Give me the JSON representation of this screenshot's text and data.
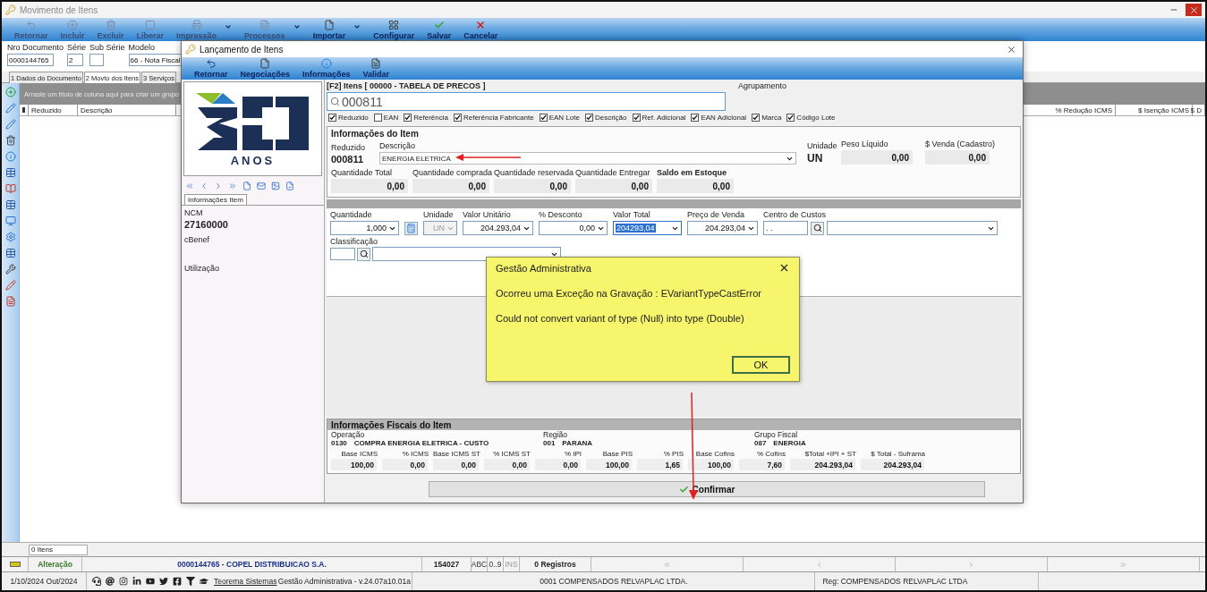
{
  "window": {
    "title": "Movimento de Itens"
  },
  "toolbar": [
    {
      "label": "Retornar",
      "disabled": true,
      "menu": false
    },
    {
      "label": "Incluir",
      "disabled": true,
      "menu": false
    },
    {
      "label": "Excluir",
      "disabled": true,
      "menu": false
    },
    {
      "label": "Liberar",
      "disabled": true,
      "menu": false
    },
    {
      "label": "Impressão",
      "disabled": true,
      "menu": true
    },
    {
      "label": "Processos",
      "disabled": true,
      "menu": true
    },
    {
      "label": "Importar",
      "disabled": false,
      "menu": true
    },
    {
      "label": "Configurar",
      "disabled": false,
      "menu": false
    },
    {
      "label": "Salvar",
      "disabled": false,
      "menu": false
    },
    {
      "label": "Cancelar",
      "disabled": false,
      "menu": false
    }
  ],
  "document_fields": [
    {
      "label": "Nro Documento",
      "value": "0000144765"
    },
    {
      "label": "Série",
      "value": "2"
    },
    {
      "label": "Sub Série"
    },
    {
      "label": "Modelo",
      "value": "66 - Nota Fiscal"
    }
  ],
  "tabs": [
    {
      "label": "1 Dados do Documento",
      "selected": false
    },
    {
      "label": "2 Movto dos Itens",
      "selected": true
    },
    {
      "label": "3 Serviços",
      "selected": false
    }
  ],
  "grid": {
    "group_hint": "Arraste um titulo de coluna aqui para criar um grupo",
    "columns": [
      "Reduzido",
      "Descrição"
    ],
    "right_columns": [
      "% Redução ICMS",
      "$ Isenção ICMS",
      "$ D"
    ]
  },
  "item_count": "0 Itens",
  "status_bar": {
    "mode": "Alteração",
    "document": "0000144765 - COPEL DISTRIBUICAO S.A.",
    "code": "154027",
    "indicators": [
      "ABC",
      "0..9",
      "INS"
    ],
    "records": "0 Registros"
  },
  "footer": {
    "date": "1/10/2024 Out/2024",
    "link": "Teorema Sistemas",
    "version": "Gestão Administrativa - v.24.07a10.01a",
    "company": "0001 COMPENSADOS RELVAPLAC LTDA.",
    "reg": "Reg: COMPENSADOS RELVAPLAC LTDA"
  },
  "dialog": {
    "title": "Lançamento de Itens",
    "toolbar": [
      "Retornar",
      "Negociações",
      "Informações",
      "Validar"
    ],
    "logo_text": "ANOS",
    "info_tab": "Informações Item",
    "info_fields": [
      {
        "label": "NCM",
        "value": "27160000"
      },
      {
        "label": "cBenef"
      },
      {
        "label": "Utilização"
      }
    ],
    "search_title": "[F2] Itens [ 00000 - TABELA DE PRECOS ]",
    "search_value": "000811",
    "grouping_label": "Agrupamento",
    "filters": [
      {
        "label": "Reduzido",
        "checked": true
      },
      {
        "label": "EAN",
        "checked": false
      },
      {
        "label": "Referência",
        "checked": true
      },
      {
        "label": "Referência Fabricante",
        "checked": true
      },
      {
        "label": "EAN Lote",
        "checked": true
      },
      {
        "label": "Descrição",
        "checked": true
      },
      {
        "label": "Ref. Adicional",
        "checked": true
      },
      {
        "label": "EAN Adicional",
        "checked": true
      },
      {
        "label": "Marca",
        "checked": true
      },
      {
        "label": "Código Lote",
        "checked": true
      }
    ],
    "item": {
      "title": "Informações do Item",
      "code_label": "Reduzido",
      "code": "000811",
      "description_label": "Descrição",
      "description": "ENERGIA ELETRICA",
      "unit_label": "Unidade",
      "unit": "UN",
      "weight_label": "Peso Líquido",
      "weight": "0,00",
      "price_label": "$ Venda (Cadastro)",
      "price": "0,00",
      "quantities": [
        {
          "label": "Quantidade Total",
          "value": "0,00"
        },
        {
          "label": "Quantidade comprada",
          "value": "0,00"
        },
        {
          "label": "Quantidade reservada",
          "value": "0,00"
        },
        {
          "label": "Quantidade Entregar",
          "value": "0,00"
        },
        {
          "label": "Saldo em Estoque",
          "value": "0,00"
        }
      ]
    },
    "entry": [
      {
        "label": "Quantidade",
        "value": "1,000",
        "kind": "dropdown"
      },
      {
        "label": "Unidade",
        "value": "UN",
        "kind": "unit"
      },
      {
        "label": "Valor Unitário",
        "value": "204.293,04",
        "kind": "dropdown"
      },
      {
        "label": "% Desconto",
        "value": "0,00",
        "kind": "dropdown"
      },
      {
        "label": "Valor Total",
        "value": "204293,04",
        "kind": "selected"
      },
      {
        "label": "Preço de Venda",
        "value": "204.293,04",
        "kind": "dropdown"
      },
      {
        "label": "Centro de Custos",
        "value": ". .",
        "kind": "lookup"
      }
    ],
    "classification_label": "Classificação",
    "fiscal": {
      "title": "Informações Fiscais do Item",
      "groups": [
        {
          "label": "Operação",
          "code": "0130",
          "name": "COMPRA ENERGIA ELETRICA - CUSTO"
        },
        {
          "label": "Região",
          "code": "001",
          "name": "PARANA"
        },
        {
          "label": "Grupo Fiscal",
          "code": "087",
          "name": "ENERGIA"
        }
      ],
      "values": [
        {
          "label": "Base ICMS",
          "value": "100,00"
        },
        {
          "label": "% ICMS",
          "value": "0,00"
        },
        {
          "label": "Base ICMS ST",
          "value": "0,00"
        },
        {
          "label": "% ICMS ST",
          "value": "0,00"
        },
        {
          "label": "% IPI",
          "value": "0,00"
        },
        {
          "label": "Base PIS",
          "value": "100,00"
        },
        {
          "label": "% PIS",
          "value": "1,65"
        },
        {
          "label": "Base Cofins",
          "value": "100,00"
        },
        {
          "label": "% Cofins",
          "value": "7,60"
        },
        {
          "label": "$Total +IPI + ST",
          "value": "204.293,04"
        },
        {
          "label": "$ Total - Suframa",
          "value": "204.293,04"
        }
      ]
    },
    "confirm": "Confirmar"
  },
  "error_dialog": {
    "title": "Gestão Administrativa",
    "lines": [
      "Ocorreu uma Exceção na Gravação : EVariantTypeCastError",
      "Could not convert variant of type (Null) into type (Double)"
    ],
    "button": "OK"
  }
}
